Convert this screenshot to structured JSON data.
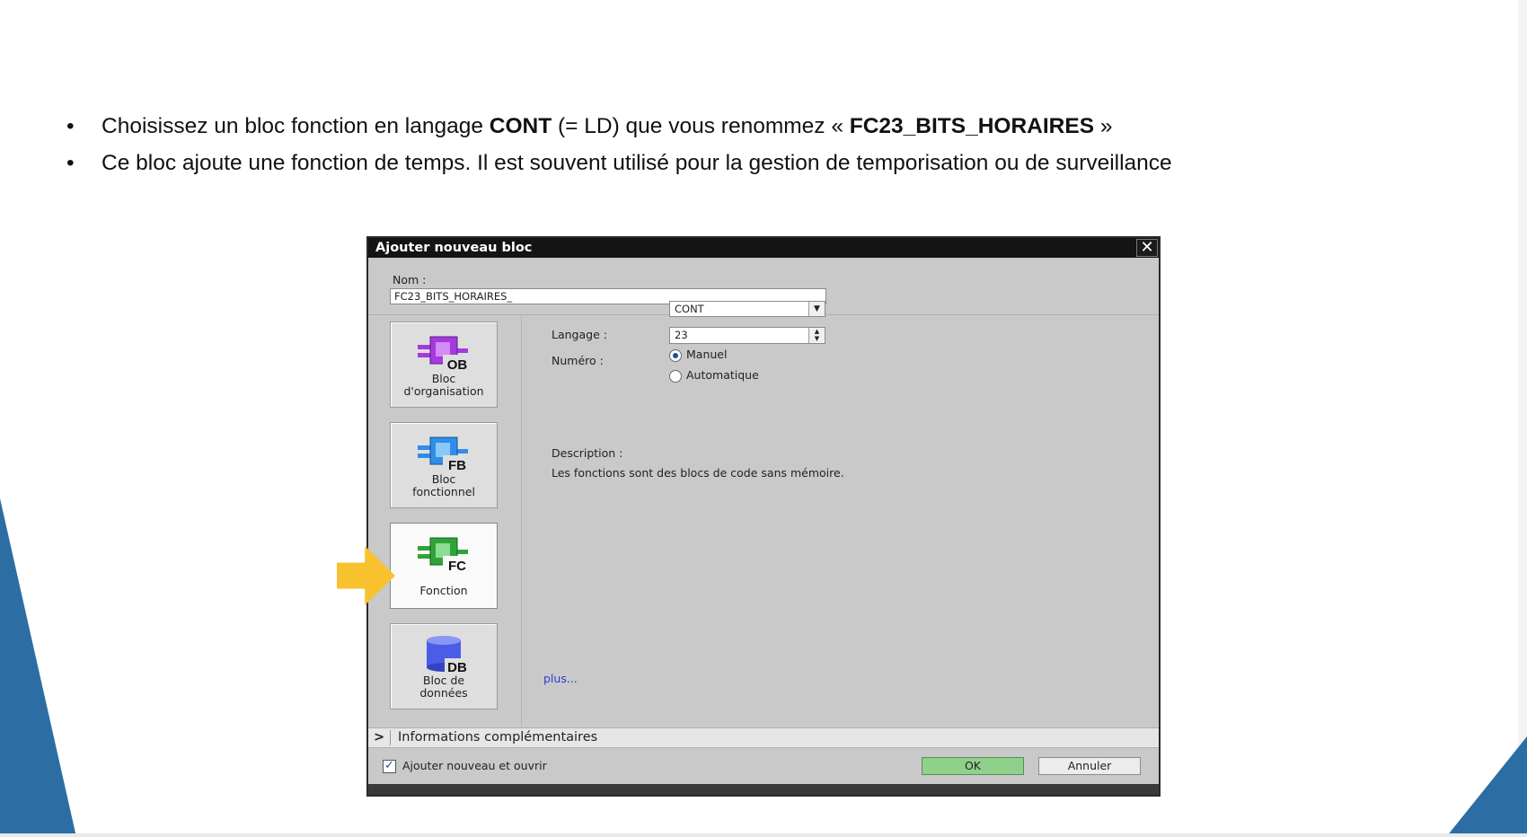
{
  "slide": {
    "bullets": [
      {
        "t1": "Choisissez un bloc fonction en langage ",
        "b1": "CONT",
        "t2": " (= LD) que vous renommez « ",
        "b2": "FC23_BITS_HORAIRES",
        "t3": " »"
      },
      {
        "t1": "Ce bloc ajoute une fonction de temps. Il est souvent utilisé pour la gestion de temporisation ou de surveillance"
      }
    ],
    "bullet_char": "•"
  },
  "dialog": {
    "title": "Ajouter nouveau bloc",
    "close_glyph": "✕",
    "name_label": "Nom :",
    "name_value": "FC23_BITS_HORAIRES_",
    "block_types": [
      {
        "label_1": "Bloc",
        "label_2": "d'organisation",
        "badge": "OB",
        "color": "#a43ae0",
        "icon": "ob-block-icon"
      },
      {
        "label_1": "Bloc",
        "label_2": "fonctionnel",
        "badge": "FB",
        "color": "#2f8ee8",
        "icon": "fb-block-icon"
      },
      {
        "label_1": "Fonction",
        "badge": "FC",
        "color": "#2fa33a",
        "icon": "fc-block-icon",
        "selected": true
      },
      {
        "label_1": "Bloc de",
        "label_2": "données",
        "badge": "DB",
        "color": "#4a5de8",
        "icon": "db-block-icon"
      }
    ],
    "language_label": "Langage :",
    "language_value": "CONT",
    "number_label": "Numéro :",
    "number_value": "23",
    "radio_manual": "Manuel",
    "radio_auto": "Automatique",
    "description_label": "Description :",
    "description_text": "Les fonctions sont des blocs de code sans mémoire.",
    "more_link": "plus...",
    "info_chevron": ">",
    "info_label": "Informations complémentaires",
    "open_checkbox_label": "Ajouter nouveau et ouvrir",
    "ok_label": "OK",
    "cancel_label": "Annuler"
  },
  "colors": {
    "accent_blue": "#2c6ea3",
    "arrow_yellow": "#f7c22e",
    "ok_green": "#8fd18a"
  }
}
